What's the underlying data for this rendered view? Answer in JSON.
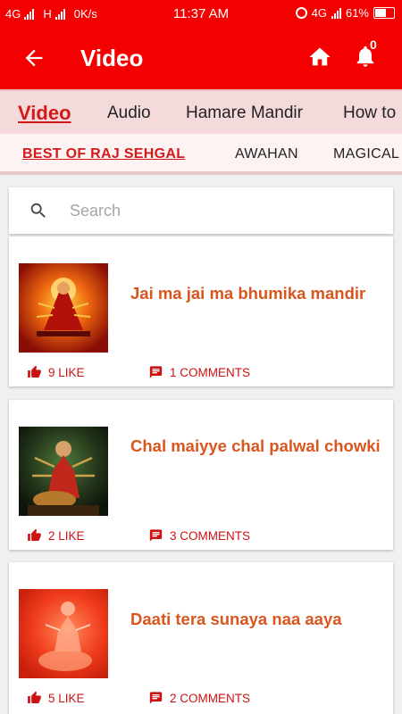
{
  "status_bar": {
    "network_left": "4G",
    "network_mid": "H",
    "speed": "0K/s",
    "time": "11:37 AM",
    "network_right": "4G",
    "battery": "61%"
  },
  "app_bar": {
    "title": "Video",
    "notification_count": "0"
  },
  "tabs": [
    "Video",
    "Audio",
    "Hamare Mandir",
    "How to"
  ],
  "subtabs": [
    "BEST OF RAJ SEHGAL",
    "AWAHAN",
    "MAGICAL"
  ],
  "search": {
    "placeholder": "Search"
  },
  "videos": [
    {
      "title": "Jai ma jai ma bhumika mandir",
      "likes": "9 LIKE",
      "comments": "1 COMMENTS"
    },
    {
      "title": "Chal maiyye chal palwal chowki",
      "likes": "2 LIKE",
      "comments": "3 COMMENTS"
    },
    {
      "title": "Daati tera sunaya naa aaya",
      "likes": "5 LIKE",
      "comments": "2 COMMENTS"
    }
  ],
  "colors": {
    "brand_red": "#f40000",
    "active_text": "#d21a1a",
    "title_orange": "#d9561e"
  }
}
